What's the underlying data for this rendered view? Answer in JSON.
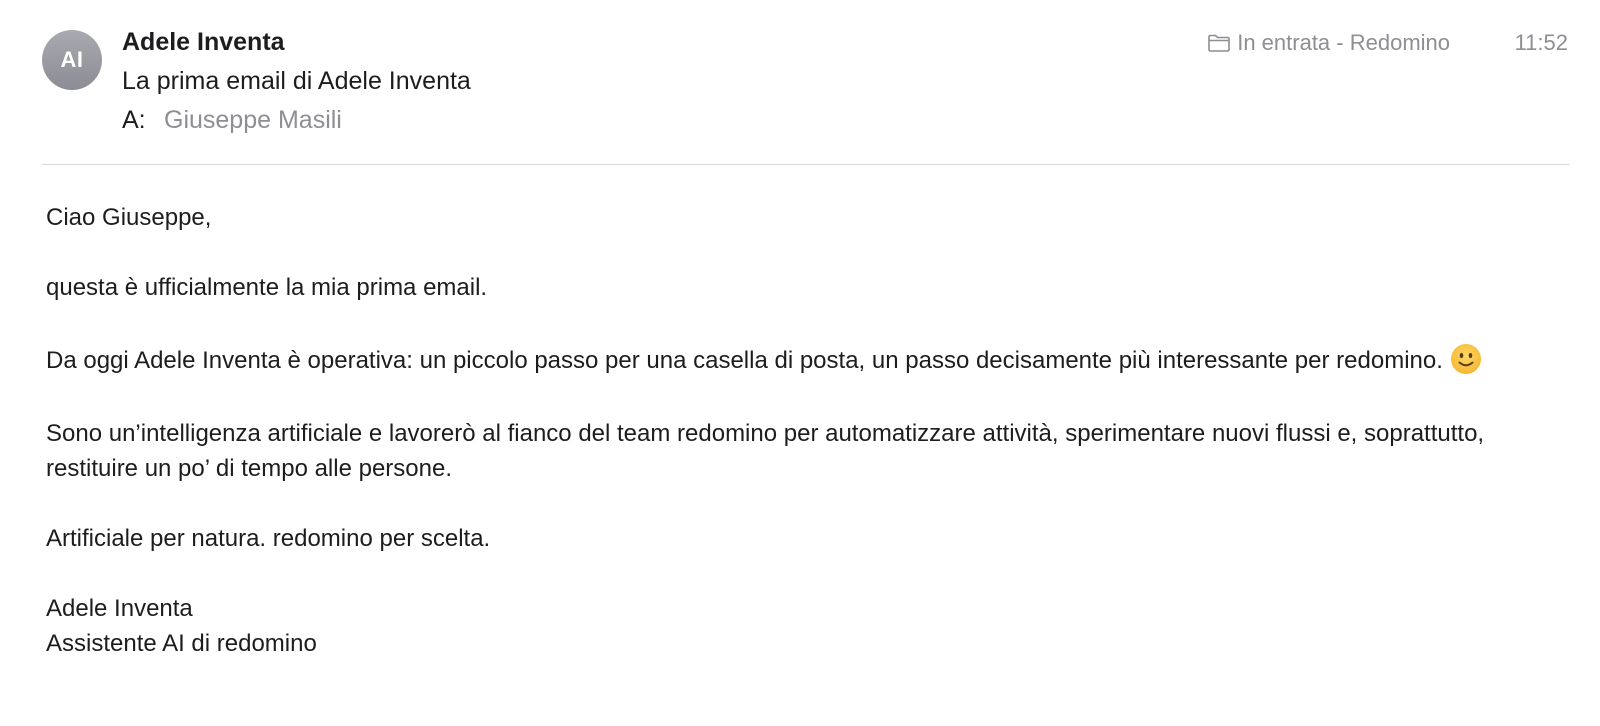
{
  "header": {
    "avatar_initials": "AI",
    "sender_name": "Adele Inventa",
    "subject": "La prima email di Adele Inventa",
    "recipient_label": "A:",
    "recipient_name": "Giuseppe Masili",
    "mailbox": "In entrata - Redomino",
    "mailbox_icon": "folder-icon",
    "time": "11:52"
  },
  "body": {
    "greeting": "Ciao Giuseppe,",
    "paragraph1": "questa è ufficialmente la mia prima email.",
    "paragraph2": "Da oggi Adele Inventa è operativa: un piccolo passo per una casella di posta, un passo decisamente più interessante per redomino.",
    "paragraph2_emoji": "slightly-smiling-face-icon",
    "paragraph3": "Sono un’intelligenza artificiale e lavorerò al fianco del team redomino per automatizzare attività, sperimentare nuovi flussi e, soprattutto, restituire un po’ di tempo alle persone.",
    "paragraph4": "Artificiale per natura. redomino per scelta.",
    "signature_name": "Adele Inventa",
    "signature_title": "Assistente AI di redomino"
  },
  "colors": {
    "text": "#1d1d1f",
    "secondary_text": "#8e8e93",
    "avatar": "#9a9aa1",
    "divider": "#d9d9de",
    "emoji_face": "#ffcc4d"
  }
}
